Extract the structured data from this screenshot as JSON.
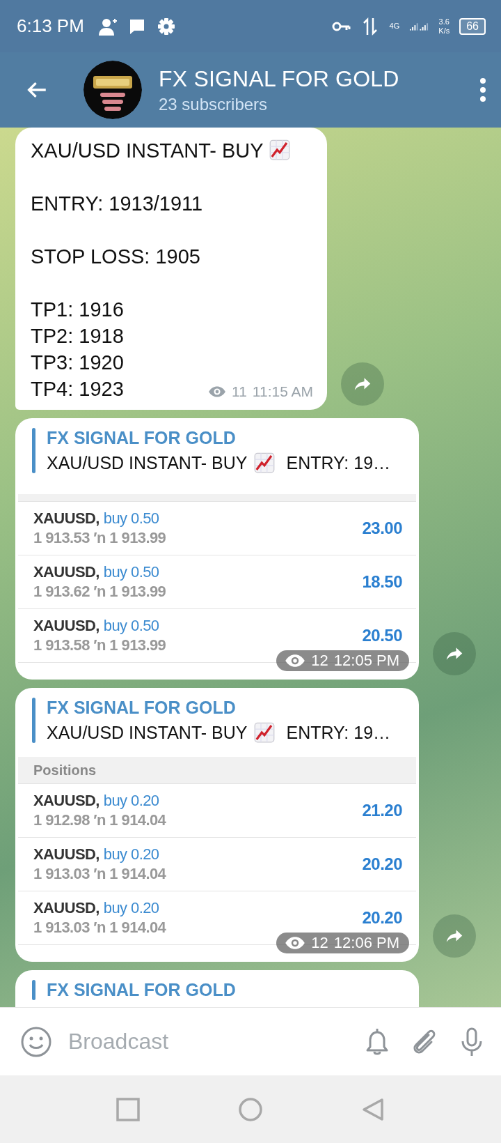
{
  "status_bar": {
    "time": "6:13 PM",
    "network": "4G",
    "speed_value": "3.6",
    "speed_unit": "K/s",
    "battery": "66"
  },
  "header": {
    "title": "FX SIGNAL FOR GOLD",
    "subtitle": "23 subscribers"
  },
  "messages": [
    {
      "kind": "text",
      "forward": true,
      "paragraphs": [
        {
          "lines": [
            "XAU/USD INSTANT- BUY"
          ],
          "trailing_chart": true
        },
        {
          "lines": [
            "ENTRY: 1913/1911"
          ]
        },
        {
          "lines": [
            "STOP LOSS: 1905"
          ]
        },
        {
          "lines": [
            "TP1: 1916",
            "TP2: 1918",
            "TP3: 1920",
            "TP4: 1923"
          ]
        }
      ],
      "views": "11",
      "time": "11:15 AM"
    },
    {
      "kind": "reply_screenshot",
      "forward": true,
      "reply": {
        "title": "FX SIGNAL FOR GOLD",
        "text_before": "XAU/USD INSTANT- BUY",
        "text_after": "ENTRY: 19…"
      },
      "positions": [
        {
          "symbol": "XAUUSD,",
          "side": "buy 0.50",
          "prices": "1 913.53 ′n  1 913.99",
          "profit": "23.00"
        },
        {
          "symbol": "XAUUSD,",
          "side": "buy 0.50",
          "prices": "1 913.62 ′n  1 913.99",
          "profit": "18.50"
        },
        {
          "symbol": "XAUUSD,",
          "side": "buy 0.50",
          "prices": "1 913.58 ′n  1 913.99",
          "profit": "20.50"
        }
      ],
      "views": "12",
      "time": "12:05 PM"
    },
    {
      "kind": "reply_screenshot",
      "forward": true,
      "reply": {
        "title": "FX SIGNAL FOR GOLD",
        "text_before": "XAU/USD INSTANT- BUY",
        "text_after": "ENTRY: 19…"
      },
      "section_title": "Positions",
      "positions": [
        {
          "symbol": "XAUUSD,",
          "side": "buy 0.20",
          "prices": "1 912.98 ′n  1 914.04",
          "profit": "21.20"
        },
        {
          "symbol": "XAUUSD,",
          "side": "buy 0.20",
          "prices": "1 913.03 ′n  1 914.04",
          "profit": "20.20"
        },
        {
          "symbol": "XAUUSD,",
          "side": "buy 0.20",
          "prices": "1 913.03 ′n  1 914.04",
          "profit": "20.20"
        }
      ],
      "views": "12",
      "time": "12:06 PM"
    },
    {
      "kind": "reply_cut",
      "forward": false,
      "reply": {
        "title": "FX SIGNAL FOR GOLD"
      }
    }
  ],
  "composer": {
    "placeholder": "Broadcast"
  }
}
